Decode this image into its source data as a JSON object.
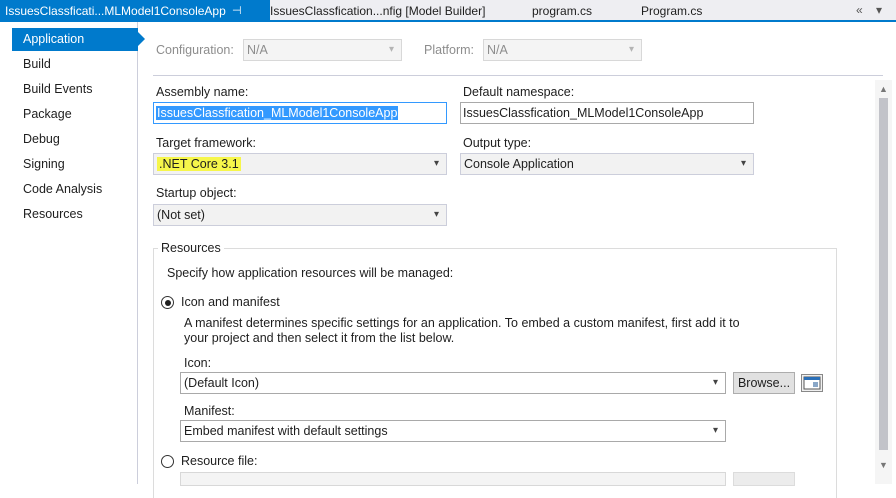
{
  "tabs": [
    {
      "label": "IssuesClassficati...MLModel1ConsoleApp",
      "active": true,
      "pin": "⊣"
    },
    {
      "label": "IssuesClassfication...nfig [Model Builder]",
      "active": false
    },
    {
      "label": "program.cs",
      "active": false
    },
    {
      "label": "Program.cs",
      "active": false
    }
  ],
  "tabbar_controls": {
    "overflow": "«",
    "dropdown": "▾"
  },
  "nav": [
    "Application",
    "Build",
    "Build Events",
    "Package",
    "Debug",
    "Signing",
    "Code Analysis",
    "Resources"
  ],
  "top": {
    "configuration_label": "Configuration:",
    "configuration_value": "N/A",
    "platform_label": "Platform:",
    "platform_value": "N/A"
  },
  "form": {
    "assembly_name_label": "Assembly name:",
    "assembly_name_value": "IssuesClassfication_MLModel1ConsoleApp",
    "default_namespace_label": "Default namespace:",
    "default_namespace_value": "IssuesClassfication_MLModel1ConsoleApp",
    "target_framework_label": "Target framework:",
    "target_framework_value": ".NET Core 3.1",
    "output_type_label": "Output type:",
    "output_type_value": "Console Application",
    "startup_object_label": "Startup object:",
    "startup_object_value": "(Not set)"
  },
  "resources": {
    "group_title": "Resources",
    "description": "Specify how application resources will be managed:",
    "icon_manifest_label": "Icon and manifest",
    "manifest_help_line1": "A manifest determines specific settings for an application. To embed a custom manifest, first add it to",
    "manifest_help_line2": "your project and then select it from the list below.",
    "icon_label": "Icon:",
    "icon_value": "(Default Icon)",
    "browse_label": "Browse...",
    "manifest_label": "Manifest:",
    "manifest_value": "Embed manifest with default settings",
    "resource_file_label": "Resource file:"
  },
  "glyphs": {
    "chevron": "▾",
    "scroll_up": "▲",
    "scroll_down": "▼"
  },
  "colors": {
    "accent": "#007acc",
    "highlight": "#f6f64b",
    "selection": "#3399ff"
  }
}
